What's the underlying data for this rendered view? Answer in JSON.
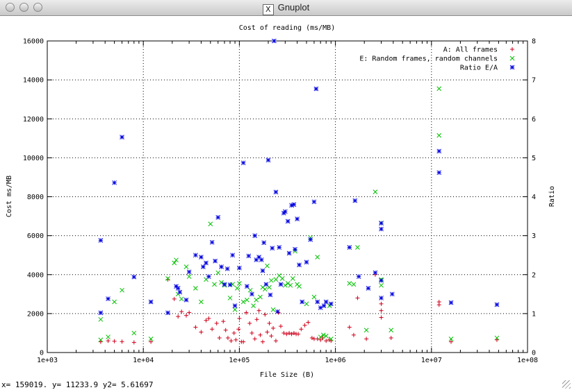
{
  "window": {
    "title": "Gnuplot",
    "icon": "x11-icon"
  },
  "status_text": "x= 159019. y= 11233.9 y2= 5.61697",
  "chart_data": {
    "type": "scatter",
    "title": "Cost of reading (ms/MB)",
    "xlabel": "File Size (B)",
    "ylabel": "Cost ms/MB",
    "y2label": "Ratio",
    "xscale": "log",
    "xlim": [
      1000,
      100000000
    ],
    "ylim": [
      0,
      16000
    ],
    "y2lim": [
      0,
      8
    ],
    "xticks": [
      "1e+03",
      "1e+04",
      "1e+05",
      "1e+06",
      "1e+07",
      "1e+08"
    ],
    "yticks": [
      "0",
      "2000",
      "4000",
      "6000",
      "8000",
      "10000",
      "12000",
      "14000",
      "16000"
    ],
    "y2ticks": [
      "0",
      "1",
      "2",
      "3",
      "4",
      "5",
      "6",
      "7",
      "8"
    ],
    "grid": true,
    "legend_position": "top-right",
    "series": [
      {
        "name": "A: All frames",
        "marker": "+",
        "color": "#d0001b",
        "axis": "y",
        "points": [
          [
            3600,
            550
          ],
          [
            4300,
            600
          ],
          [
            5000,
            580
          ],
          [
            6000,
            560
          ],
          [
            8000,
            520
          ],
          [
            12000,
            550
          ],
          [
            18000,
            3750
          ],
          [
            21000,
            2750
          ],
          [
            23000,
            1850
          ],
          [
            25000,
            2100
          ],
          [
            28000,
            1900
          ],
          [
            30000,
            2050
          ],
          [
            35000,
            1300
          ],
          [
            40000,
            1050
          ],
          [
            45000,
            1650
          ],
          [
            48000,
            1750
          ],
          [
            52000,
            1200
          ],
          [
            58000,
            1500
          ],
          [
            62000,
            750
          ],
          [
            68000,
            1600
          ],
          [
            72000,
            1150
          ],
          [
            76000,
            750
          ],
          [
            82000,
            600
          ],
          [
            88000,
            1000
          ],
          [
            92000,
            650
          ],
          [
            98000,
            1200
          ],
          [
            100000,
            1750
          ],
          [
            105000,
            550
          ],
          [
            110000,
            550
          ],
          [
            118000,
            2050
          ],
          [
            128000,
            1500
          ],
          [
            135000,
            1000
          ],
          [
            145000,
            700
          ],
          [
            152000,
            1700
          ],
          [
            160000,
            2150
          ],
          [
            165000,
            900
          ],
          [
            175000,
            550
          ],
          [
            185000,
            1950
          ],
          [
            195000,
            1050
          ],
          [
            205000,
            1500
          ],
          [
            215000,
            850
          ],
          [
            225000,
            1250
          ],
          [
            240000,
            600
          ],
          [
            255000,
            2050
          ],
          [
            270000,
            1350
          ],
          [
            290000,
            1000
          ],
          [
            310000,
            950
          ],
          [
            330000,
            1000
          ],
          [
            350000,
            950
          ],
          [
            370000,
            1000
          ],
          [
            390000,
            950
          ],
          [
            410000,
            950
          ],
          [
            440000,
            1200
          ],
          [
            480000,
            1400
          ],
          [
            520000,
            1550
          ],
          [
            570000,
            750
          ],
          [
            600000,
            700
          ],
          [
            650000,
            700
          ],
          [
            700000,
            650
          ],
          [
            740000,
            750
          ],
          [
            800000,
            600
          ],
          [
            860000,
            650
          ],
          [
            900000,
            600
          ],
          [
            1400000,
            1300
          ],
          [
            1550000,
            900
          ],
          [
            1700000,
            2800
          ],
          [
            2100000,
            700
          ],
          [
            2600000,
            4000
          ],
          [
            3000000,
            2500
          ],
          [
            3000000,
            2150
          ],
          [
            3000000,
            1800
          ],
          [
            3800000,
            750
          ],
          [
            12000000,
            2600
          ],
          [
            12000000,
            2450
          ],
          [
            16000000,
            550
          ],
          [
            48000000,
            650
          ]
        ]
      },
      {
        "name": "E: Random frames, random channels",
        "marker": "x",
        "color": "#00c000",
        "axis": "y",
        "points": [
          [
            3600,
            1700
          ],
          [
            3600,
            650
          ],
          [
            4300,
            800
          ],
          [
            5000,
            2600
          ],
          [
            6000,
            3200
          ],
          [
            8000,
            1000
          ],
          [
            12000,
            700
          ],
          [
            18000,
            3800
          ],
          [
            21000,
            4600
          ],
          [
            22000,
            4750
          ],
          [
            23000,
            3000
          ],
          [
            25000,
            2750
          ],
          [
            28000,
            4400
          ],
          [
            30000,
            3900
          ],
          [
            35000,
            3300
          ],
          [
            40000,
            2600
          ],
          [
            45000,
            3750
          ],
          [
            50000,
            6600
          ],
          [
            55000,
            3500
          ],
          [
            60000,
            4100
          ],
          [
            65000,
            3600
          ],
          [
            70000,
            3450
          ],
          [
            80000,
            2800
          ],
          [
            85000,
            3500
          ],
          [
            90000,
            2200
          ],
          [
            95000,
            3300
          ],
          [
            100000,
            3550
          ],
          [
            110000,
            2600
          ],
          [
            120000,
            2700
          ],
          [
            130000,
            3200
          ],
          [
            140000,
            2400
          ],
          [
            150000,
            2700
          ],
          [
            165000,
            2850
          ],
          [
            175000,
            3350
          ],
          [
            185000,
            3250
          ],
          [
            195000,
            4450
          ],
          [
            205000,
            3350
          ],
          [
            215000,
            3700
          ],
          [
            225000,
            2200
          ],
          [
            240000,
            3750
          ],
          [
            260000,
            3950
          ],
          [
            280000,
            3800
          ],
          [
            300000,
            3450
          ],
          [
            320000,
            3550
          ],
          [
            340000,
            3450
          ],
          [
            360000,
            3800
          ],
          [
            380000,
            5200
          ],
          [
            400000,
            3500
          ],
          [
            420000,
            3400
          ],
          [
            500000,
            2500
          ],
          [
            550000,
            5900
          ],
          [
            600000,
            2850
          ],
          [
            650000,
            4900
          ],
          [
            700000,
            800
          ],
          [
            750000,
            900
          ],
          [
            800000,
            850
          ],
          [
            870000,
            2400
          ],
          [
            900000,
            700
          ],
          [
            1400000,
            3550
          ],
          [
            1550000,
            3500
          ],
          [
            1700000,
            5400
          ],
          [
            2100000,
            1150
          ],
          [
            2600000,
            8250
          ],
          [
            3000000,
            3750
          ],
          [
            3000000,
            3450
          ],
          [
            3000000,
            6650
          ],
          [
            3800000,
            1150
          ],
          [
            12000000,
            13550
          ],
          [
            12000000,
            11150
          ],
          [
            16000000,
            700
          ],
          [
            48000000,
            750
          ]
        ]
      },
      {
        "name": "Ratio E/A",
        "marker": "*",
        "color": "#0000e0",
        "axis": "y2",
        "points": [
          [
            3600,
            2.88
          ],
          [
            3600,
            1.02
          ],
          [
            4300,
            1.38
          ],
          [
            5000,
            4.36
          ],
          [
            6000,
            5.53
          ],
          [
            8000,
            1.94
          ],
          [
            12000,
            1.3
          ],
          [
            18000,
            1.02
          ],
          [
            22000,
            1.7
          ],
          [
            23000,
            1.65
          ],
          [
            24000,
            1.55
          ],
          [
            28000,
            1.35
          ],
          [
            30000,
            2.07
          ],
          [
            35000,
            2.5
          ],
          [
            40000,
            2.45
          ],
          [
            42000,
            2.2
          ],
          [
            45000,
            2.3
          ],
          [
            48000,
            1.95
          ],
          [
            52000,
            2.83
          ],
          [
            56000,
            2.35
          ],
          [
            60000,
            3.47
          ],
          [
            65000,
            2.2
          ],
          [
            70000,
            1.75
          ],
          [
            75000,
            2.15
          ],
          [
            80000,
            1.74
          ],
          [
            85000,
            2.5
          ],
          [
            90000,
            1.2
          ],
          [
            100000,
            2.17
          ],
          [
            110000,
            4.87
          ],
          [
            120000,
            1.7
          ],
          [
            125000,
            2.48
          ],
          [
            135000,
            1.5
          ],
          [
            145000,
            3.0
          ],
          [
            150000,
            2.38
          ],
          [
            160000,
            2.45
          ],
          [
            170000,
            2.38
          ],
          [
            175000,
            2.1
          ],
          [
            180000,
            2.82
          ],
          [
            190000,
            1.75
          ],
          [
            200000,
            4.94
          ],
          [
            210000,
            1.48
          ],
          [
            220000,
            2.68
          ],
          [
            230000,
            8.0
          ],
          [
            240000,
            4.12
          ],
          [
            250000,
            1.05
          ],
          [
            260000,
            2.7
          ],
          [
            270000,
            1.75
          ],
          [
            290000,
            3.58
          ],
          [
            300000,
            3.62
          ],
          [
            320000,
            3.37
          ],
          [
            330000,
            2.55
          ],
          [
            350000,
            3.78
          ],
          [
            370000,
            3.8
          ],
          [
            380000,
            2.65
          ],
          [
            400000,
            3.43
          ],
          [
            420000,
            2.25
          ],
          [
            450000,
            1.3
          ],
          [
            500000,
            2.32
          ],
          [
            550000,
            2.9
          ],
          [
            600000,
            3.87
          ],
          [
            630000,
            6.77
          ],
          [
            650000,
            1.3
          ],
          [
            700000,
            1.15
          ],
          [
            760000,
            1.2
          ],
          [
            800000,
            1.3
          ],
          [
            900000,
            1.25
          ],
          [
            1400000,
            2.7
          ],
          [
            1600000,
            3.9
          ],
          [
            1750000,
            1.95
          ],
          [
            2200000,
            1.65
          ],
          [
            2600000,
            2.05
          ],
          [
            3000000,
            3.17
          ],
          [
            3000000,
            1.85
          ],
          [
            3000000,
            1.4
          ],
          [
            3000000,
            3.32
          ],
          [
            3900000,
            1.5
          ],
          [
            12000000,
            5.17
          ],
          [
            12000000,
            4.62
          ],
          [
            16000000,
            1.28
          ],
          [
            48000000,
            1.23
          ]
        ]
      }
    ]
  }
}
